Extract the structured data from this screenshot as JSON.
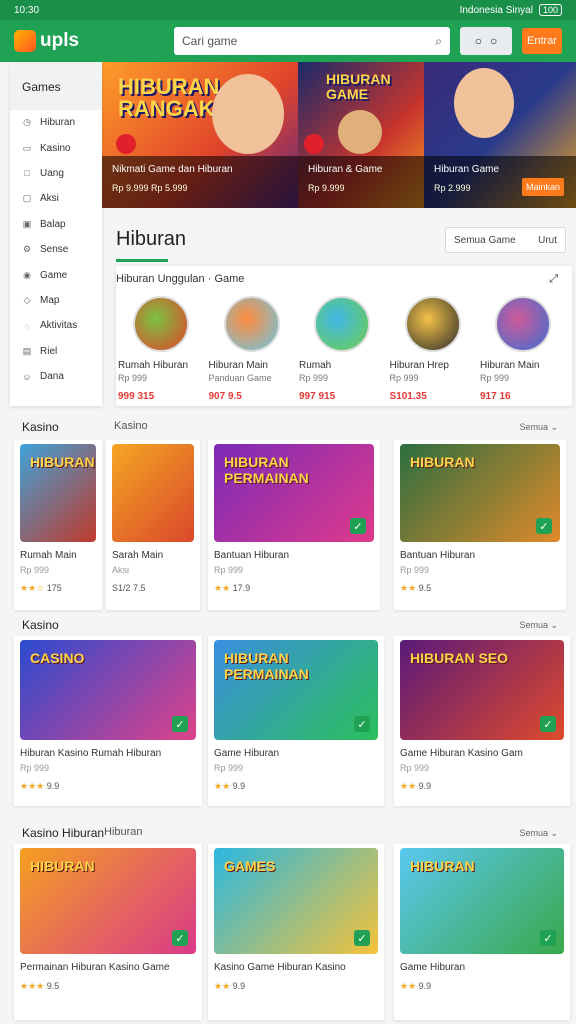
{
  "status": {
    "time": "10:30",
    "right_text": "Indonesia Sinyal",
    "battery": "100"
  },
  "app": {
    "logo_text": "upls",
    "search_placeholder": "Cari game",
    "enter_label": "Entrar"
  },
  "sidebar": {
    "title": "Games",
    "items": [
      {
        "icon": "clock-icon",
        "glyph": "◷",
        "label": "Hiburan"
      },
      {
        "icon": "card-icon",
        "glyph": "▭",
        "label": "Kasino"
      },
      {
        "icon": "box-icon",
        "glyph": "□",
        "label": "Uang"
      },
      {
        "icon": "box-icon",
        "glyph": "▢",
        "label": "Aksi"
      },
      {
        "icon": "box-icon",
        "glyph": "▣",
        "label": "Balap"
      },
      {
        "icon": "gear-icon",
        "glyph": "⚙",
        "label": "Sense"
      },
      {
        "icon": "pin-icon",
        "glyph": "◉",
        "label": "Game"
      },
      {
        "icon": "shield-icon",
        "glyph": "◇",
        "label": "Map"
      },
      {
        "icon": "chat-icon",
        "glyph": "◌",
        "label": "Aktivitas"
      },
      {
        "icon": "box-icon",
        "glyph": "▤",
        "label": "Riel"
      },
      {
        "icon": "smile-icon",
        "glyph": "☺",
        "label": "Dana"
      }
    ]
  },
  "hero": [
    {
      "title": "HIBURAN\nRANGAK",
      "caption": "Nikmati Game dan Hiburan",
      "sub": "Rp 9.999  Rp 5.999"
    },
    {
      "title": "HIBURAN\nGAME",
      "caption": "Hiburan & Game",
      "sub": "Rp 9.999"
    },
    {
      "title": "",
      "caption": "Hiburan Game",
      "sub": "Rp 2.999",
      "cta": "Mainkan"
    }
  ],
  "main": {
    "title": "Hiburan",
    "filter_label": "Semua Game",
    "filter_right": "Urut"
  },
  "featured": {
    "title": "Hiburan Unggulan · Game",
    "more": "⤢",
    "items": [
      {
        "name": "Rumah Hiburan",
        "meta": "Rp 999",
        "price": "999 315",
        "color1": "#7cc242",
        "color2": "#e0432b"
      },
      {
        "name": "Hiburan Main",
        "meta": "Panduan Game",
        "price": "907 9.5",
        "color1": "#ff8a3c",
        "color2": "#6bc8e6"
      },
      {
        "name": "Rumah",
        "meta": "Rp 999",
        "price": "997 915",
        "color1": "#3fb6e8",
        "color2": "#6fcf4a"
      },
      {
        "name": "Hiburan Hrep",
        "meta": "Rp 999",
        "price": "S101.35",
        "color1": "#f4c247",
        "color2": "#2b2b2b"
      },
      {
        "name": "Hiburan Main",
        "meta": "Rp 999",
        "price": "917 16",
        "color1": "#d05a9a",
        "color2": "#3a6fd0"
      }
    ]
  },
  "categories": [
    {
      "title": "Kasino",
      "subtitle": "Kasino",
      "more": "Semua  ⌄",
      "cards": [
        {
          "title": "HIBURAN",
          "name": "Rumah Main",
          "sub": "Rp 999",
          "stars": "★★☆",
          "rating": "175",
          "g1": "#3fa2d9",
          "g2": "#c0392b"
        },
        {
          "title": "",
          "name": "Sarah Main",
          "sub": "Aksi",
          "stars": "",
          "rating": "S1/2 7.5",
          "g1": "#f5a623",
          "g2": "#d9472b"
        },
        {
          "title": "HIBURAN\nPERMAINAN",
          "name": "Bantuan Hiburan",
          "sub": "Rp 999",
          "stars": "★★",
          "rating": "17.9",
          "g1": "#7b2ab8",
          "g2": "#e03a8a"
        },
        {
          "title": "HIBURAN",
          "name": "Bantuan Hiburan",
          "sub": "Rp 999",
          "stars": "★★",
          "rating": "9.5",
          "g1": "#2b6e3f",
          "g2": "#e08a2b"
        }
      ]
    },
    {
      "title": "Kasino",
      "subtitle": "",
      "more": "Semua  ⌄",
      "cards": [
        {
          "title": "CASINO",
          "name": "Hiburan Kasino Rumah Hiburan",
          "sub": "Rp 999",
          "stars": "★★★",
          "rating": "9.9",
          "g1": "#2b4bd0",
          "g2": "#e0438a"
        },
        {
          "title": "HIBURAN\nPERMAINAN",
          "name": "Game Hiburan",
          "sub": "Rp 999",
          "stars": "★★",
          "rating": "9.9",
          "g1": "#3a8fe0",
          "g2": "#2bbf5a"
        },
        {
          "title": "HIBURAN SEO",
          "name": "Game Hiburan Kasino Gam",
          "sub": "Rp 999",
          "stars": "★★",
          "rating": "9.9",
          "g1": "#5a1a7a",
          "g2": "#e04a2b"
        }
      ]
    },
    {
      "title": "Kasino Hiburan",
      "subtitle": "Hiburan",
      "more": "Semua  ⌄",
      "cards": [
        {
          "title": "HIBURAN",
          "name": "Permainan Hiburan Kasino Game",
          "sub": "",
          "stars": "★★★",
          "rating": "9.5",
          "g1": "#f59f21",
          "g2": "#d93a8a"
        },
        {
          "title": "GAMES",
          "name": "Kasino Game Hiburan Kasino",
          "sub": "",
          "stars": "★★",
          "rating": "9.9",
          "g1": "#2bb8e0",
          "g2": "#f5c23a"
        },
        {
          "title": "HIBURAN",
          "name": "Game Hiburan",
          "sub": "",
          "stars": "★★",
          "rating": "9.9",
          "g1": "#5ac8f0",
          "g2": "#3aa84a"
        }
      ]
    }
  ]
}
